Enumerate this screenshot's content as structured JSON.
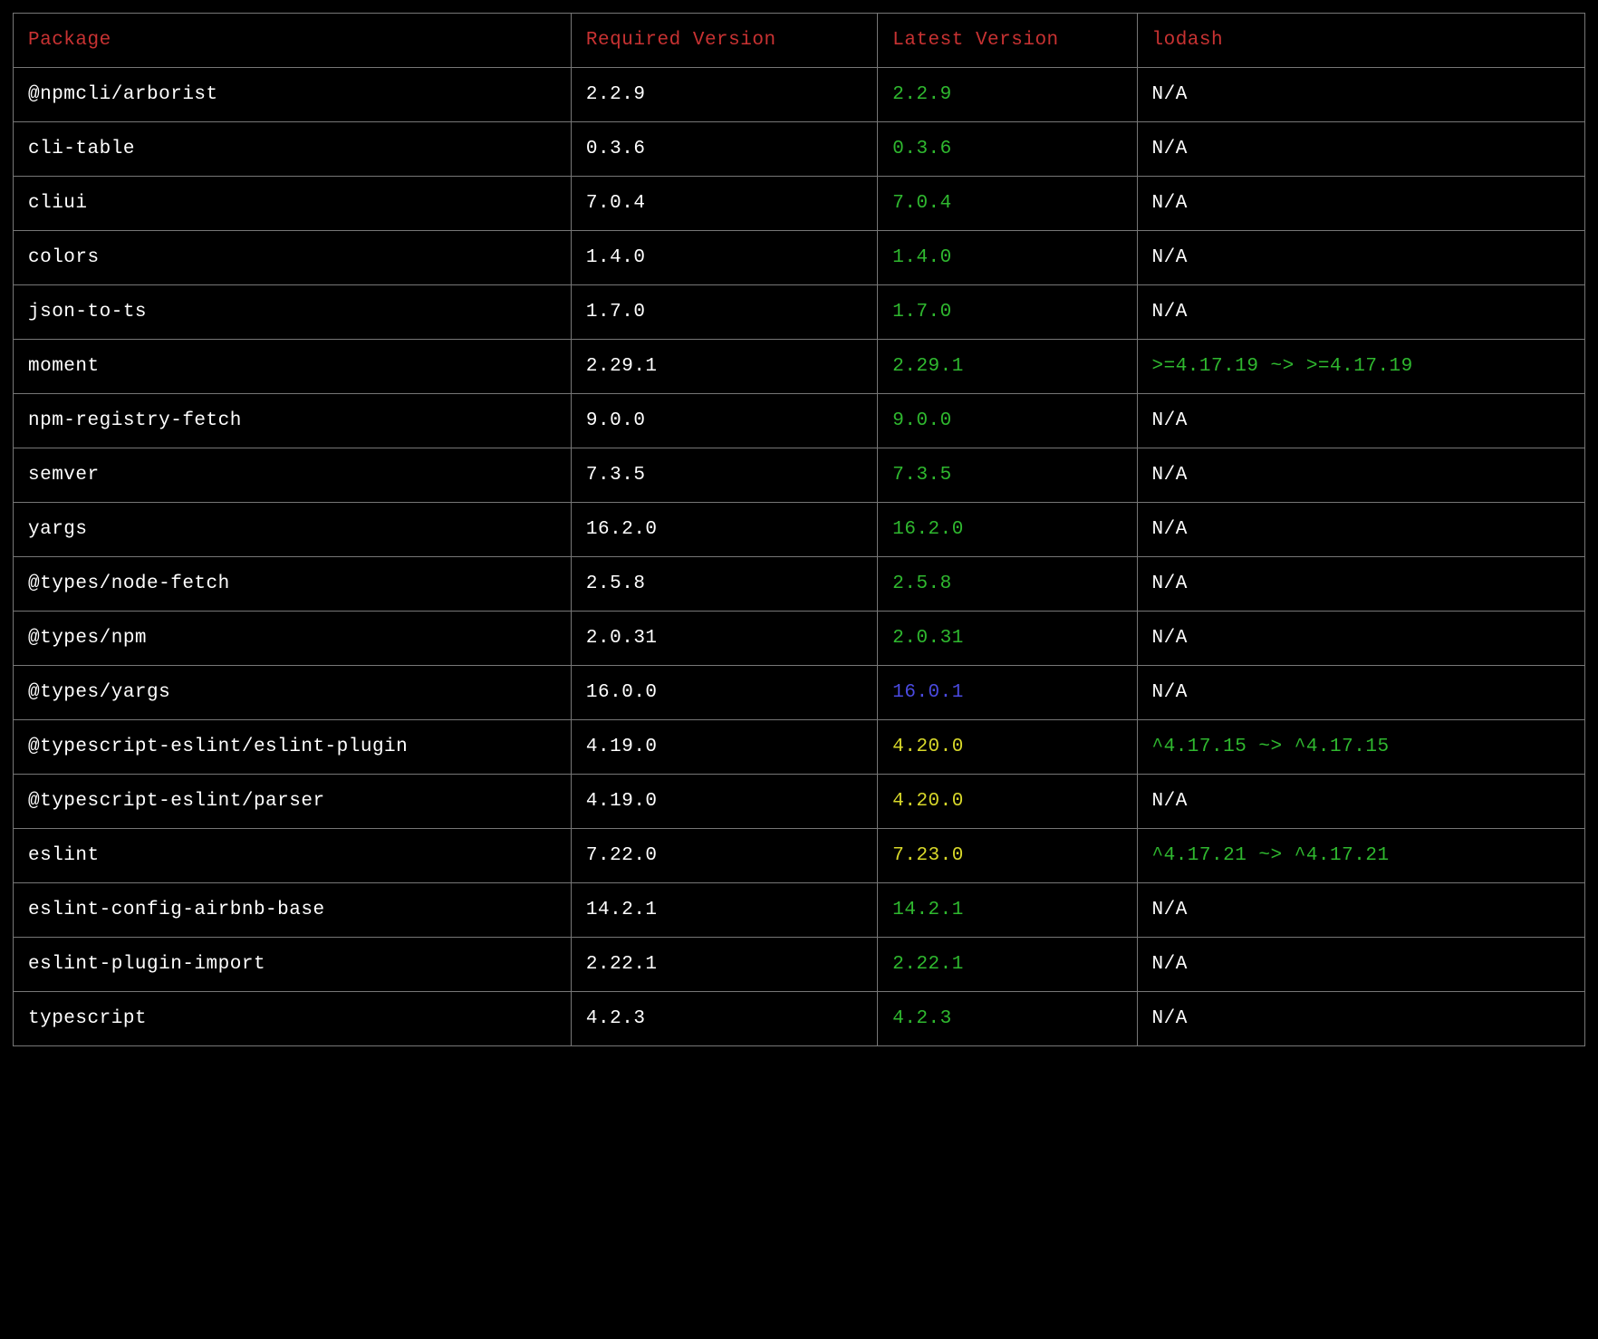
{
  "headers": {
    "package": "Package",
    "required": "Required Version",
    "latest": "Latest Version",
    "lodash": "lodash"
  },
  "colors": {
    "header": "#c83232",
    "white": "#ffffff",
    "green": "#2fb82f",
    "yellow": "#d8d82a",
    "blue": "#4a4ae0",
    "border": "#777777",
    "background": "#000000"
  },
  "rows": [
    {
      "package": "@npmcli/arborist",
      "required": "2.2.9",
      "latest": "2.2.9",
      "latest_color": "green",
      "lodash": "N/A",
      "lodash_color": "white"
    },
    {
      "package": "cli-table",
      "required": "0.3.6",
      "latest": "0.3.6",
      "latest_color": "green",
      "lodash": "N/A",
      "lodash_color": "white"
    },
    {
      "package": "cliui",
      "required": "7.0.4",
      "latest": "7.0.4",
      "latest_color": "green",
      "lodash": "N/A",
      "lodash_color": "white"
    },
    {
      "package": "colors",
      "required": "1.4.0",
      "latest": "1.4.0",
      "latest_color": "green",
      "lodash": "N/A",
      "lodash_color": "white"
    },
    {
      "package": "json-to-ts",
      "required": "1.7.0",
      "latest": "1.7.0",
      "latest_color": "green",
      "lodash": "N/A",
      "lodash_color": "white"
    },
    {
      "package": "moment",
      "required": "2.29.1",
      "latest": "2.29.1",
      "latest_color": "green",
      "lodash": ">=4.17.19 ~> >=4.17.19",
      "lodash_color": "green"
    },
    {
      "package": "npm-registry-fetch",
      "required": "9.0.0",
      "latest": "9.0.0",
      "latest_color": "green",
      "lodash": "N/A",
      "lodash_color": "white"
    },
    {
      "package": "semver",
      "required": "7.3.5",
      "latest": "7.3.5",
      "latest_color": "green",
      "lodash": "N/A",
      "lodash_color": "white"
    },
    {
      "package": "yargs",
      "required": "16.2.0",
      "latest": "16.2.0",
      "latest_color": "green",
      "lodash": "N/A",
      "lodash_color": "white"
    },
    {
      "package": "@types/node-fetch",
      "required": "2.5.8",
      "latest": "2.5.8",
      "latest_color": "green",
      "lodash": "N/A",
      "lodash_color": "white"
    },
    {
      "package": "@types/npm",
      "required": "2.0.31",
      "latest": "2.0.31",
      "latest_color": "green",
      "lodash": "N/A",
      "lodash_color": "white"
    },
    {
      "package": "@types/yargs",
      "required": "16.0.0",
      "latest": "16.0.1",
      "latest_color": "blue",
      "lodash": "N/A",
      "lodash_color": "white"
    },
    {
      "package": "@typescript-eslint/eslint-plugin",
      "required": "4.19.0",
      "latest": "4.20.0",
      "latest_color": "yellow",
      "lodash": "^4.17.15 ~> ^4.17.15",
      "lodash_color": "green"
    },
    {
      "package": "@typescript-eslint/parser",
      "required": "4.19.0",
      "latest": "4.20.0",
      "latest_color": "yellow",
      "lodash": "N/A",
      "lodash_color": "white"
    },
    {
      "package": "eslint",
      "required": "7.22.0",
      "latest": "7.23.0",
      "latest_color": "yellow",
      "lodash": "^4.17.21 ~> ^4.17.21",
      "lodash_color": "green"
    },
    {
      "package": "eslint-config-airbnb-base",
      "required": "14.2.1",
      "latest": "14.2.1",
      "latest_color": "green",
      "lodash": "N/A",
      "lodash_color": "white"
    },
    {
      "package": "eslint-plugin-import",
      "required": "2.22.1",
      "latest": "2.22.1",
      "latest_color": "green",
      "lodash": "N/A",
      "lodash_color": "white"
    },
    {
      "package": "typescript",
      "required": "4.2.3",
      "latest": "4.2.3",
      "latest_color": "green",
      "lodash": "N/A",
      "lodash_color": "white"
    }
  ]
}
